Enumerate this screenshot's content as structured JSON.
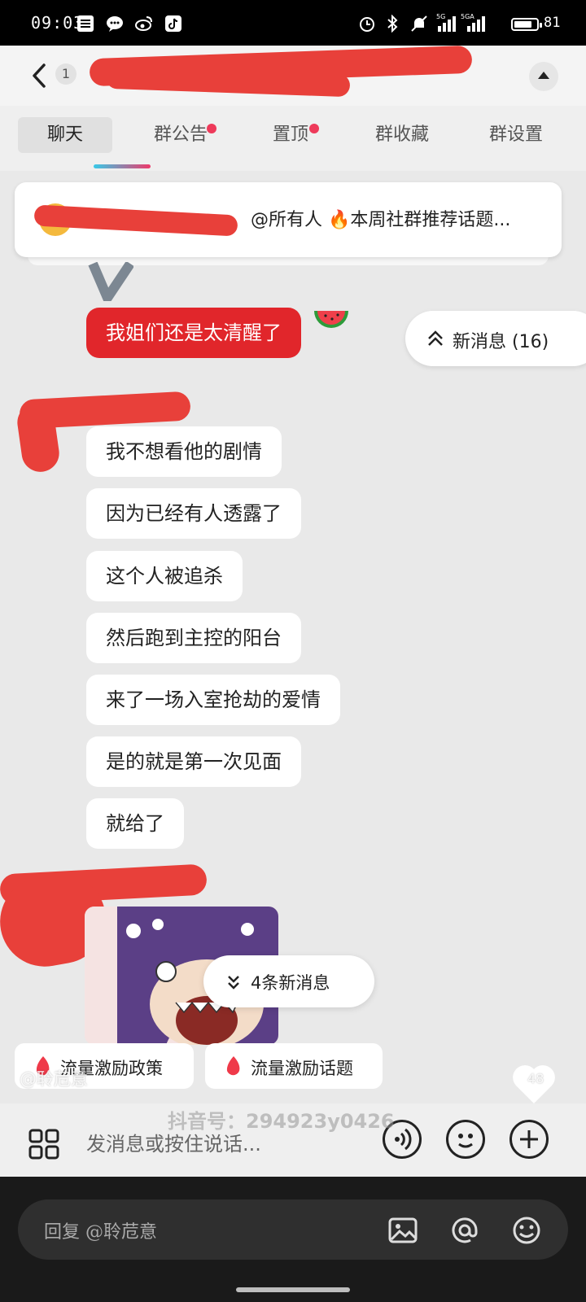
{
  "status_bar": {
    "time": "09:03",
    "battery": "81",
    "battery_level": 0.81,
    "signal_1": "5G",
    "signal_2": "5GA"
  },
  "header": {
    "back_count": "1"
  },
  "tabs": [
    {
      "label": "聊天",
      "active": true,
      "dot": false
    },
    {
      "label": "群公告",
      "active": false,
      "dot": true
    },
    {
      "label": "置顶",
      "active": false,
      "dot": true
    },
    {
      "label": "群收藏",
      "active": false,
      "dot": false
    },
    {
      "label": "群设置",
      "active": false,
      "dot": false
    }
  ],
  "pinned": {
    "text": "@所有人 🔥本周社群推荐话题..."
  },
  "messages": {
    "sent": "我姐们还是太清醒了",
    "received": [
      "我不想看他的剧情",
      "因为已经有人透露了",
      "这个人被追杀",
      "然后跑到主控的阳台",
      "来了一场入室抢劫的爱情",
      "是的就是第一次见面",
      "就给了"
    ]
  },
  "new_messages_pill": "新消息 (16)",
  "new_messages_bottom": "4条新消息",
  "chips": [
    {
      "label": "流量激励政策"
    },
    {
      "label": "流量激励话题"
    }
  ],
  "overlay": {
    "handle": "@聆苊意",
    "count": "48"
  },
  "input": {
    "placeholder": "发消息或按住说话...",
    "watermark": "抖音号：294923y0426"
  },
  "reply_bar": {
    "placeholder": "回复 @聆苊意"
  },
  "colors": {
    "accent_red": "#e1262b",
    "redaction": "#e8403a",
    "tab_dot": "#ee3a5a"
  }
}
